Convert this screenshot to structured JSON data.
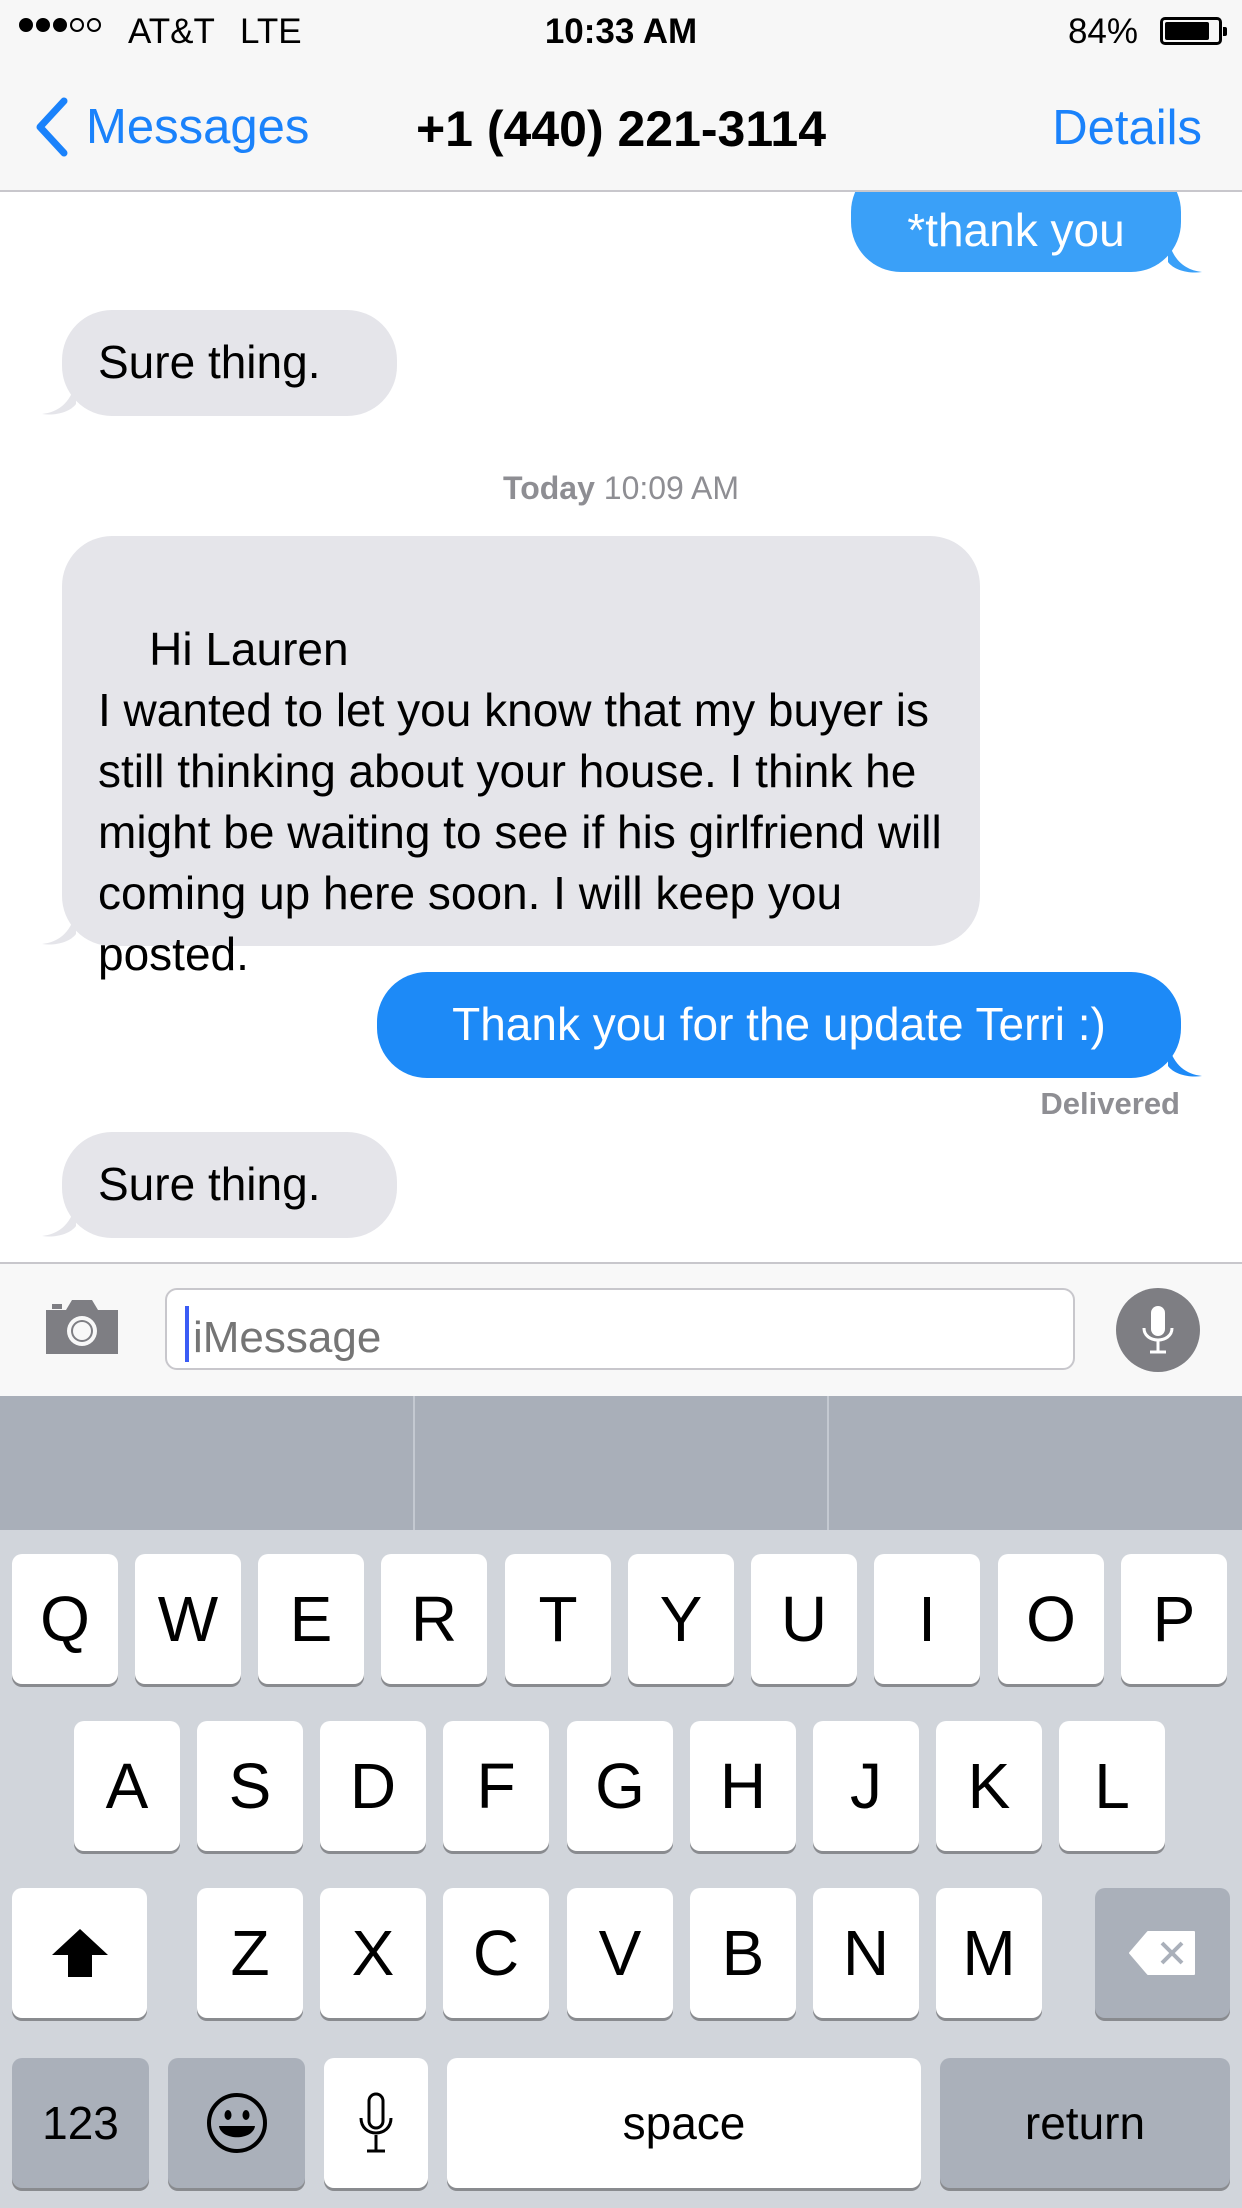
{
  "status_bar": {
    "carrier": "AT&T",
    "network": "LTE",
    "time": "10:33 AM",
    "battery_percent": "84%",
    "battery_level": 0.84,
    "signal_bars": 3,
    "signal_total": 5
  },
  "nav": {
    "back_label": "Messages",
    "title": "+1 (440) 221-3114",
    "details_label": "Details"
  },
  "messages": {
    "m1": "*thank you",
    "m2": "Sure thing.",
    "timestamp_day": "Today",
    "timestamp_time": "10:09 AM",
    "m3": "Hi Lauren\nI wanted to let you know that my buyer is still thinking about your house. I think he might be waiting to see if his girlfriend will coming up here soon. I will keep you posted.",
    "m4": "Thank you for the update Terri :)",
    "m4_status": "Delivered",
    "m5": "Sure thing."
  },
  "input": {
    "placeholder": "iMessage",
    "value": ""
  },
  "keyboard": {
    "row1": [
      "Q",
      "W",
      "E",
      "R",
      "T",
      "Y",
      "U",
      "I",
      "O",
      "P"
    ],
    "row2": [
      "A",
      "S",
      "D",
      "F",
      "G",
      "H",
      "J",
      "K",
      "L"
    ],
    "row3": [
      "Z",
      "X",
      "C",
      "V",
      "B",
      "N",
      "M"
    ],
    "numbers_label": "123",
    "space_label": "space",
    "return_label": "return"
  },
  "colors": {
    "accent": "#1a82fb",
    "outgoing_bubble": "#1d8af7",
    "incoming_bubble": "#e5e5ea",
    "keyboard_bg": "#d1d5db"
  },
  "icons": {
    "back": "chevron-left-icon",
    "camera": "camera-icon",
    "mic": "microphone-icon",
    "shift": "shift-icon",
    "delete": "delete-backspace-icon",
    "emoji": "emoji-icon",
    "dictation": "dictation-icon"
  }
}
